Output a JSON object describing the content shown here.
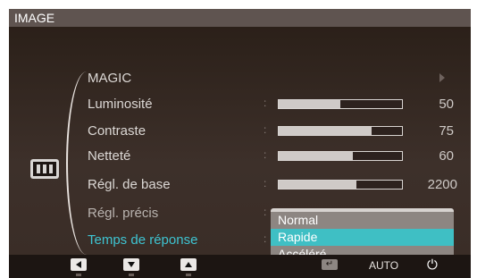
{
  "osd": {
    "title": "IMAGE",
    "menu": [
      {
        "label": "MAGIC",
        "type": "submenu"
      },
      {
        "label": "Luminosité",
        "type": "slider",
        "value": "50",
        "fill": 0.5
      },
      {
        "label": "Contraste",
        "type": "slider",
        "value": "75",
        "fill": 0.75
      },
      {
        "label": "Netteté",
        "type": "slider",
        "value": "60",
        "fill": 0.6
      },
      {
        "label": "Régl. de base",
        "type": "slider",
        "value": "2200",
        "fill": 0.63
      },
      {
        "label": "Régl. précis",
        "type": "dropdown-host"
      },
      {
        "label": "Temps de réponse",
        "type": "active"
      }
    ],
    "dropdown": {
      "options": [
        "Normal",
        "Rapide",
        "Accéléré"
      ],
      "selected": "Rapide"
    },
    "bottom": {
      "auto_label": "AUTO",
      "power_glyph": "⏻",
      "enter_glyph": "↵"
    },
    "colors": {
      "accent": "#3fbfc4",
      "active_text": "#3ec4d2",
      "background": "#312622"
    },
    "side_icon": "picture-mode-icon"
  }
}
